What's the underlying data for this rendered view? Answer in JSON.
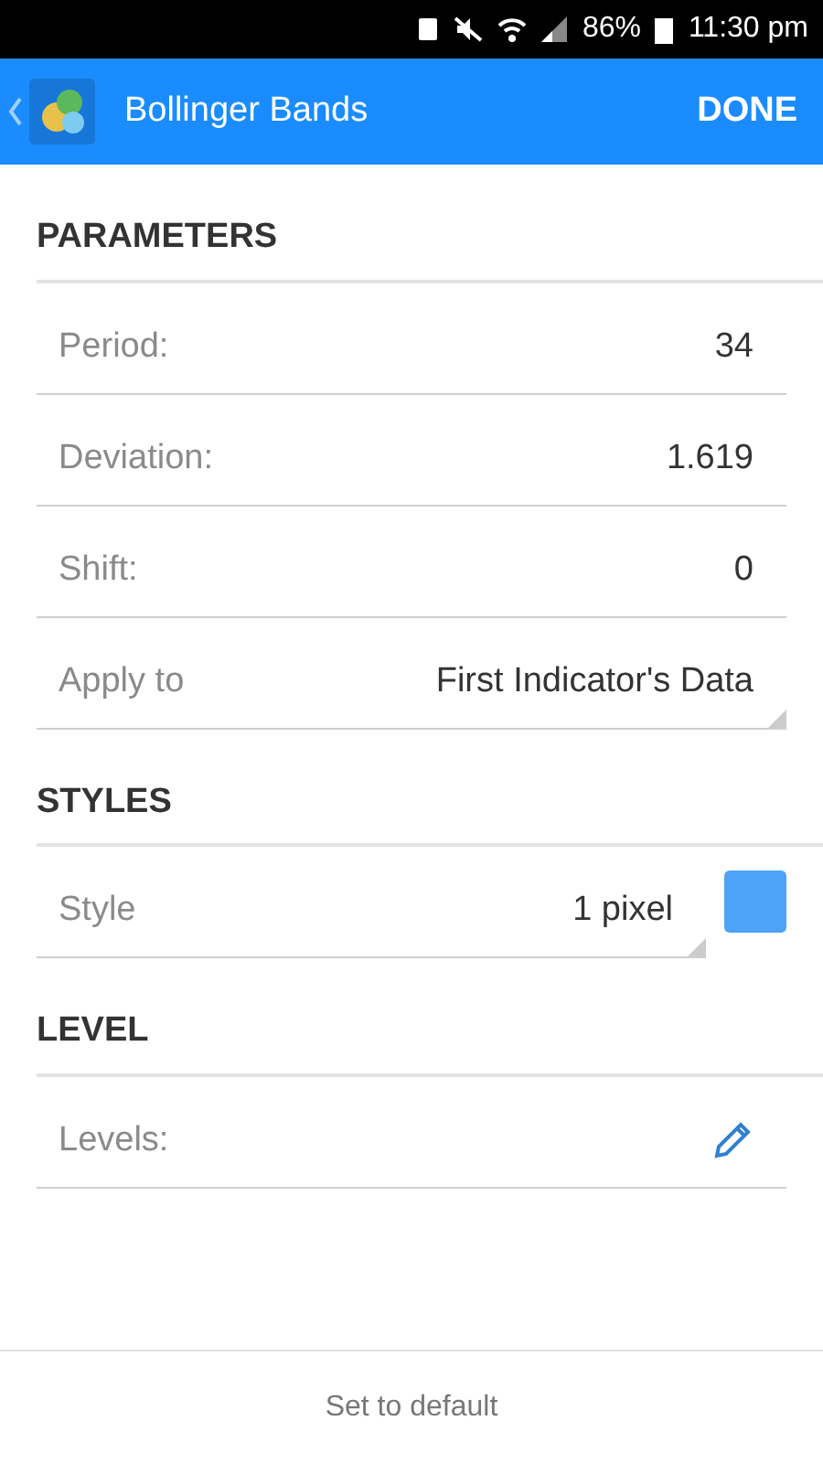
{
  "status_bar": {
    "battery": "86%",
    "time": "11:30 pm"
  },
  "app_bar": {
    "title": "Bollinger Bands",
    "action": "DONE"
  },
  "sections": [
    {
      "title": "PARAMETERS",
      "rows": [
        {
          "kind": "field",
          "label": "Period:",
          "value": "34"
        },
        {
          "kind": "field",
          "label": "Deviation:",
          "value": "1.619"
        },
        {
          "kind": "field",
          "label": "Shift:",
          "value": "0"
        },
        {
          "kind": "dropdown",
          "label": "Apply to",
          "value": "First Indicator's Data"
        }
      ]
    },
    {
      "title": "STYLES",
      "rows": [
        {
          "kind": "style",
          "label": "Style",
          "value": "1 pixel",
          "color": "#4da3f7"
        }
      ]
    },
    {
      "title": "LEVEL",
      "rows": [
        {
          "kind": "edit",
          "label": "Levels:"
        }
      ]
    }
  ],
  "footer_button": "Set to default"
}
